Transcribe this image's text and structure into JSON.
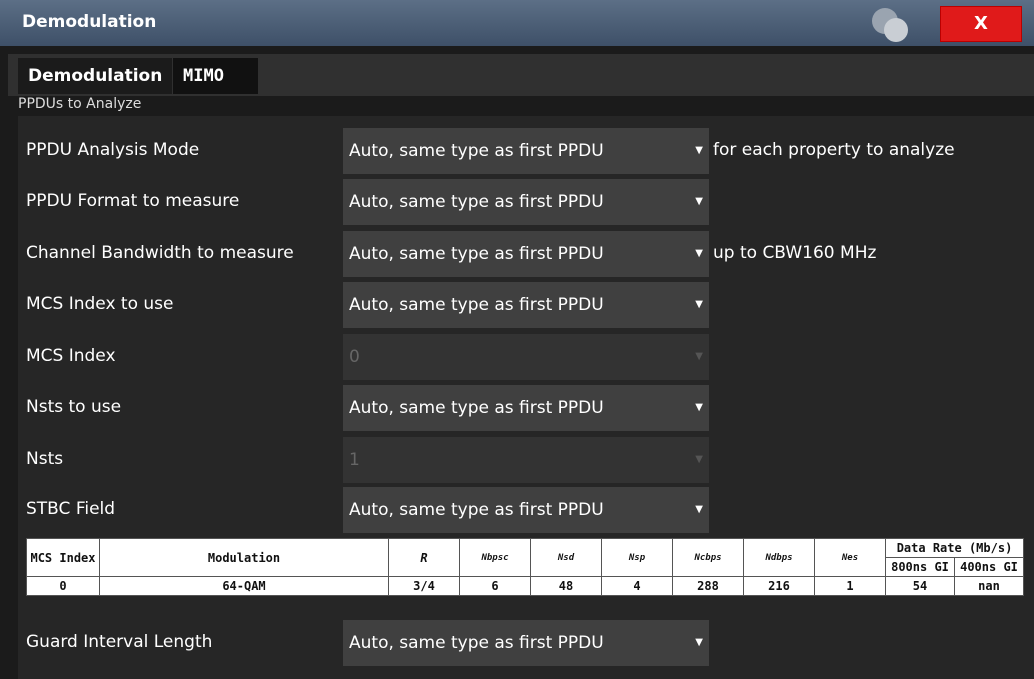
{
  "window": {
    "title": "Demodulation",
    "close_label": "X"
  },
  "tabs": [
    {
      "label": "Demodulation"
    },
    {
      "label": "MIMO"
    }
  ],
  "section": {
    "title": "PPDUs to Analyze"
  },
  "rows": [
    {
      "label": "PPDU Analysis Mode",
      "value": "Auto, same type as first PPDU",
      "note": "for each property to analyze"
    },
    {
      "label": "PPDU Format to measure",
      "value": "Auto, same type as first PPDU",
      "note": ""
    },
    {
      "label": "Channel Bandwidth to measure",
      "value": "Auto, same type as first PPDU",
      "note": "up to CBW160 MHz"
    },
    {
      "label": "MCS Index to use",
      "value": "Auto, same type as first PPDU",
      "note": ""
    },
    {
      "label": "MCS Index",
      "value": "0",
      "note": ""
    },
    {
      "label": "Nsts to use",
      "value": "Auto, same type as first PPDU",
      "note": ""
    },
    {
      "label": "Nsts",
      "value": "1",
      "note": ""
    },
    {
      "label": "STBC Field",
      "value": "Auto, same type as first PPDU",
      "note": ""
    }
  ],
  "mcs_table": {
    "headers": {
      "mcs_index": "MCS Index",
      "modulation": "Modulation",
      "r": "R",
      "nbpsc": "Nbpsc",
      "nsd": "Nsd",
      "nsp": "Nsp",
      "ncbps": "Ncbps",
      "ndbps": "Ndbps",
      "nes": "Nes",
      "data_rate": "Data Rate (Mb/s)",
      "gi800": "800ns GI",
      "gi400": "400ns GI"
    },
    "row": [
      "0",
      "64-QAM",
      "3/4",
      "6",
      "48",
      "4",
      "288",
      "216",
      "1",
      "54",
      "nan"
    ]
  },
  "guard": {
    "label": "Guard Interval Length",
    "value": "Auto, same type as first PPDU"
  }
}
